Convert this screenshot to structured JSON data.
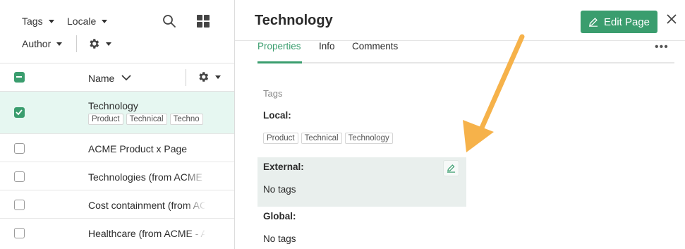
{
  "filters": {
    "tags_label": "Tags",
    "locale_label": "Locale",
    "author_label": "Author"
  },
  "list": {
    "header_name": "Name",
    "rows": [
      {
        "name": "Technology",
        "selected": true,
        "tags": [
          "Product",
          "Technical",
          "Techno"
        ]
      },
      {
        "name": "ACME Product x Page",
        "selected": false
      },
      {
        "name": "Technologies (from ACME -",
        "selected": false
      },
      {
        "name": "Cost containment (from AC",
        "selected": false
      },
      {
        "name": "Healthcare (from ACME - A",
        "selected": false
      }
    ]
  },
  "detail": {
    "title": "Technology",
    "edit_label": "Edit Page",
    "tabs": [
      "Properties",
      "Info",
      "Comments"
    ],
    "section_title": "Tags",
    "local_label": "Local:",
    "local_tags": [
      "Product",
      "Technical",
      "Technology"
    ],
    "external_label": "External:",
    "external_value": "No tags",
    "global_label": "Global:",
    "global_value": "No tags"
  },
  "colors": {
    "accent": "#3a9d6e",
    "selected_row_bg": "#e6f7f1",
    "external_bg": "#e9efed",
    "annotation_arrow": "#f6b24a"
  },
  "icons": [
    "search-icon",
    "grid-icon",
    "gear-icon",
    "chevron-down-icon",
    "pencil-icon",
    "close-icon",
    "more-icon"
  ]
}
